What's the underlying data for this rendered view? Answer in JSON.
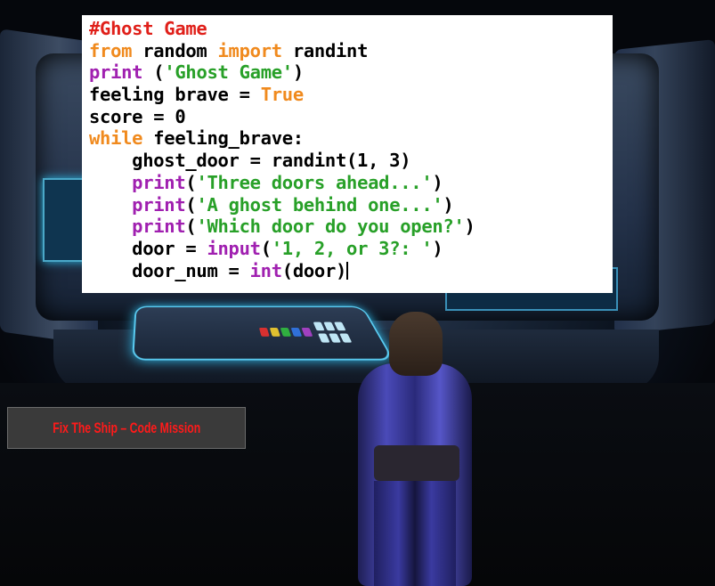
{
  "code_panel": {
    "lines": [
      [
        {
          "t": "#Ghost Game",
          "c": "#e0201a"
        }
      ],
      [
        {
          "t": "from",
          "c": "#f08a1e"
        },
        {
          "t": " random ",
          "c": "#000000"
        },
        {
          "t": "import",
          "c": "#f08a1e"
        },
        {
          "t": " randint",
          "c": "#000000"
        }
      ],
      [
        {
          "t": "print",
          "c": "#a020b0"
        },
        {
          "t": " (",
          "c": "#000000"
        },
        {
          "t": "'Ghost Game'",
          "c": "#28a028"
        },
        {
          "t": ")",
          "c": "#000000"
        }
      ],
      [
        {
          "t": "feeling brave = ",
          "c": "#000000"
        },
        {
          "t": "True",
          "c": "#f08a1e"
        }
      ],
      [
        {
          "t": "score = 0",
          "c": "#000000"
        }
      ],
      [
        {
          "t": "while",
          "c": "#f08a1e"
        },
        {
          "t": " feeling_brave:",
          "c": "#000000"
        }
      ],
      [
        {
          "t": "    ghost_door = randint(1, 3)",
          "c": "#000000"
        }
      ],
      [
        {
          "t": "    ",
          "c": "#000000"
        },
        {
          "t": "print",
          "c": "#a020b0"
        },
        {
          "t": "(",
          "c": "#000000"
        },
        {
          "t": "'Three doors ahead...'",
          "c": "#28a028"
        },
        {
          "t": ")",
          "c": "#000000"
        }
      ],
      [
        {
          "t": "    ",
          "c": "#000000"
        },
        {
          "t": "print",
          "c": "#a020b0"
        },
        {
          "t": "(",
          "c": "#000000"
        },
        {
          "t": "'A ghost behind one...'",
          "c": "#28a028"
        },
        {
          "t": ")",
          "c": "#000000"
        }
      ],
      [
        {
          "t": "    ",
          "c": "#000000"
        },
        {
          "t": "print",
          "c": "#a020b0"
        },
        {
          "t": "(",
          "c": "#000000"
        },
        {
          "t": "'Which door do you open?'",
          "c": "#28a028"
        },
        {
          "t": ")",
          "c": "#000000"
        }
      ],
      [
        {
          "t": "    door = ",
          "c": "#000000"
        },
        {
          "t": "input",
          "c": "#a020b0"
        },
        {
          "t": "(",
          "c": "#000000"
        },
        {
          "t": "'1, 2, or 3?: '",
          "c": "#28a028"
        },
        {
          "t": ")",
          "c": "#000000"
        }
      ],
      [
        {
          "t": "    door_num = ",
          "c": "#000000"
        },
        {
          "t": "int",
          "c": "#a020b0"
        },
        {
          "t": "(door)",
          "c": "#000000"
        }
      ]
    ]
  },
  "mission_label": "Fix The Ship – Code Mission",
  "colors": {
    "keyword_orange": "#f08a1e",
    "builtin_purple": "#a020b0",
    "string_green": "#28a028",
    "comment_red": "#e0201a",
    "mission_text_red": "#ff1a1a",
    "glow_cyan": "#59c9ef"
  }
}
